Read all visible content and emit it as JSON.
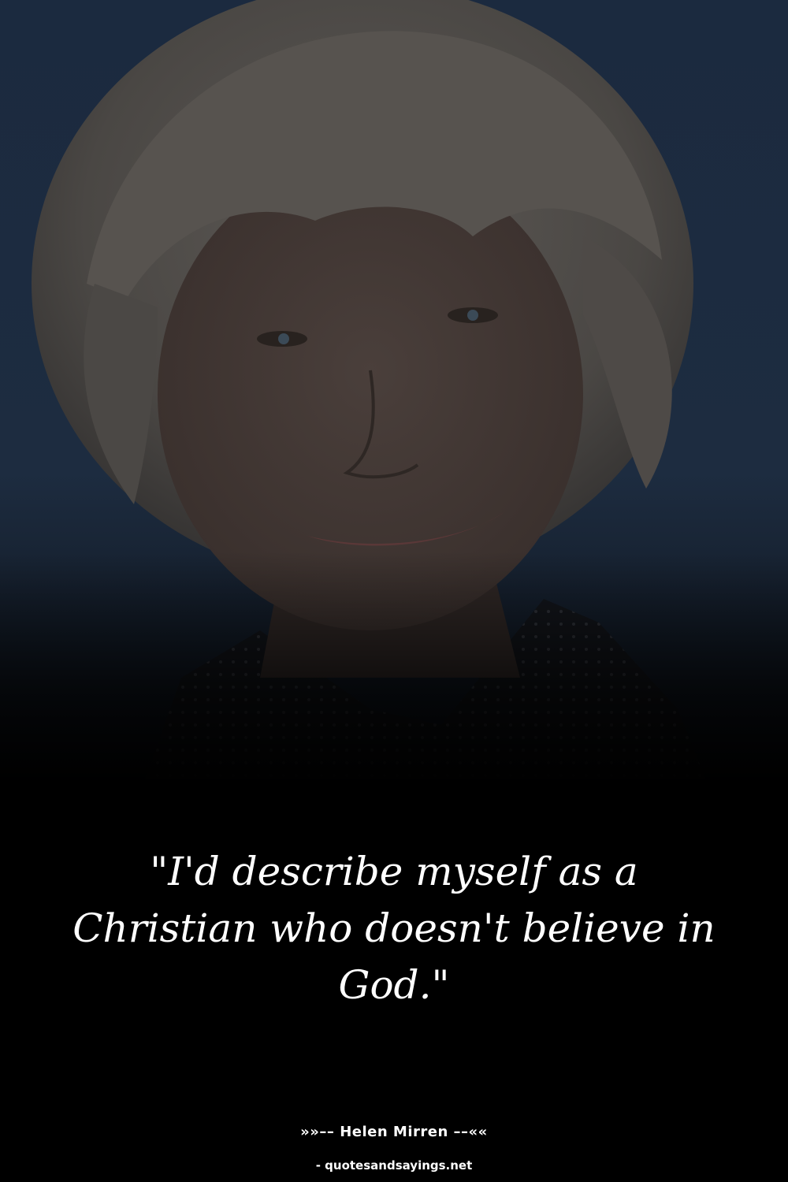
{
  "quote": {
    "text": "\"I'd describe myself as a Christian who doesn't believe in God.\""
  },
  "attribution": {
    "author_line": "»»–– Helen Mirren ––««"
  },
  "source": {
    "site_line": "- quotesandsayings.net"
  },
  "colors": {
    "background": "#000000",
    "backdrop_blue": "#1d2b3e",
    "text": "#ffffff"
  }
}
